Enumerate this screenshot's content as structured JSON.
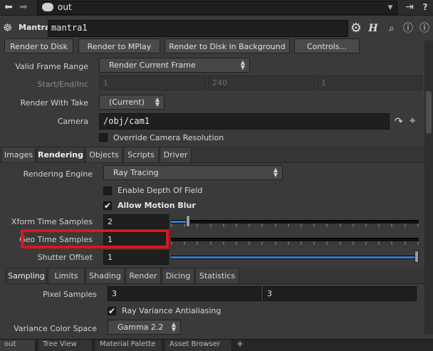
{
  "topbar": {
    "back_icon": "arrow-left-icon",
    "forward_icon": "arrow-right-icon",
    "path": "out",
    "pin_icon": "pin-icon",
    "help_icon": "help-icon"
  },
  "node": {
    "type": "Mantra",
    "name": "mantra1",
    "icons": [
      "gear-icon",
      "h-icon",
      "search-icon",
      "info-icon",
      "help-icon"
    ]
  },
  "buttons": {
    "render_to_disk": "Render to Disk",
    "render_to_mplay": "Render to MPlay",
    "render_bg": "Render to Disk in Background",
    "controls": "Controls..."
  },
  "params": {
    "valid_frame_range": {
      "label": "Valid Frame Range",
      "value": "Render Current Frame"
    },
    "start_end_inc": {
      "label": "Start/End/Inc",
      "values": [
        "1",
        "240",
        "1"
      ]
    },
    "render_with_take": {
      "label": "Render With Take",
      "value": "(Current)"
    },
    "camera": {
      "label": "Camera",
      "value": "/obj/cam1"
    },
    "override_camera_resolution": {
      "label": "Override Camera Resolution",
      "checked": false
    }
  },
  "tabs": [
    "Images",
    "Rendering",
    "Objects",
    "Scripts",
    "Driver"
  ],
  "active_tab": "Rendering",
  "rendering": {
    "engine": {
      "label": "Rendering Engine",
      "value": "Ray Tracing"
    },
    "depth_of_field": {
      "label": "Enable Depth Of Field",
      "checked": false
    },
    "motion_blur": {
      "label": "Allow Motion Blur",
      "checked": true
    },
    "xform_time_samples": {
      "label": "Xform Time Samples",
      "value": "2",
      "slider_fraction": 0.07
    },
    "geo_time_samples": {
      "label": "Geo Time Samples",
      "value": "1",
      "slider_fraction": 0.0
    },
    "shutter_offset": {
      "label": "Shutter Offset",
      "value": "1",
      "slider_fraction": 1.0
    }
  },
  "subtabs": [
    "Sampling",
    "Limits",
    "Shading",
    "Render",
    "Dicing",
    "Statistics"
  ],
  "active_subtab": "Sampling",
  "sampling": {
    "pixel_samples": {
      "label": "Pixel Samples",
      "values": [
        "3",
        "3"
      ]
    },
    "ray_variance": {
      "label": "Ray Variance Antialiasing",
      "checked": true
    },
    "variance_color_space": {
      "label": "Variance Color Space",
      "value": "Gamma 2.2"
    }
  },
  "bottom_tabs": [
    "out",
    "Tree View",
    "Material Palette",
    "Asset Browser"
  ],
  "colors": {
    "highlight": "#e0141c",
    "slider_fill": "#3a7bc8",
    "background": "#3a3a3a"
  }
}
